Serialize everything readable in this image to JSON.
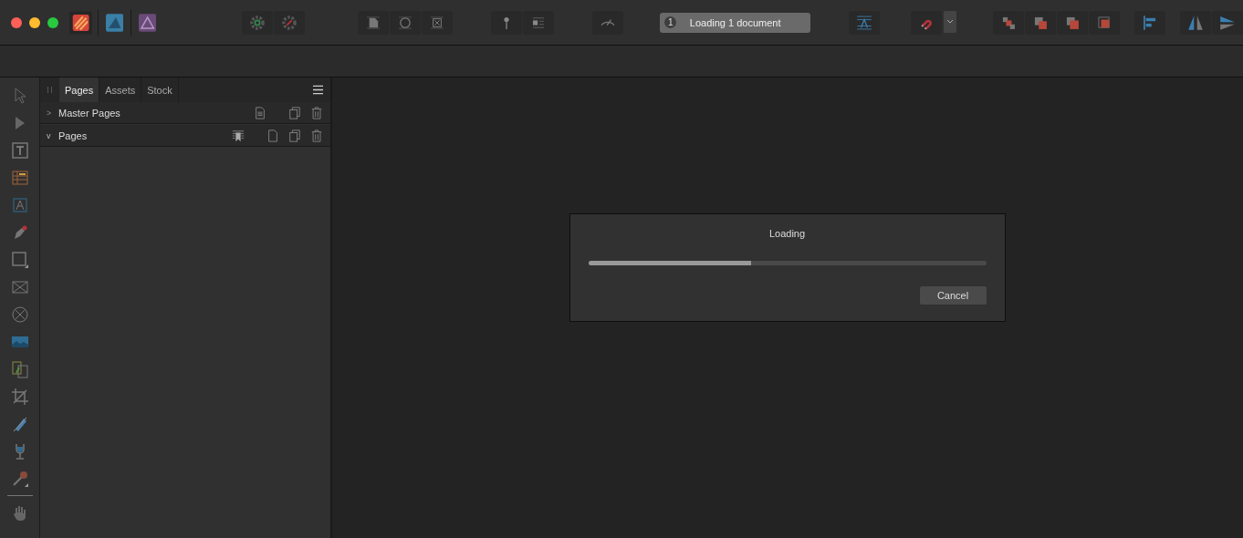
{
  "toolbar": {
    "status": {
      "count": "1",
      "label": "Loading 1 document"
    }
  },
  "panel": {
    "tabs": [
      {
        "label": "Pages",
        "selected": true
      },
      {
        "label": "Assets",
        "selected": false
      },
      {
        "label": "Stock",
        "selected": false
      }
    ],
    "sections": [
      {
        "label": "Master Pages",
        "expanded": false,
        "chevron": ">"
      },
      {
        "label": "Pages",
        "expanded": true,
        "chevron": "v"
      }
    ]
  },
  "dialog": {
    "title": "Loading",
    "level": 0.41,
    "button": "Cancel"
  }
}
